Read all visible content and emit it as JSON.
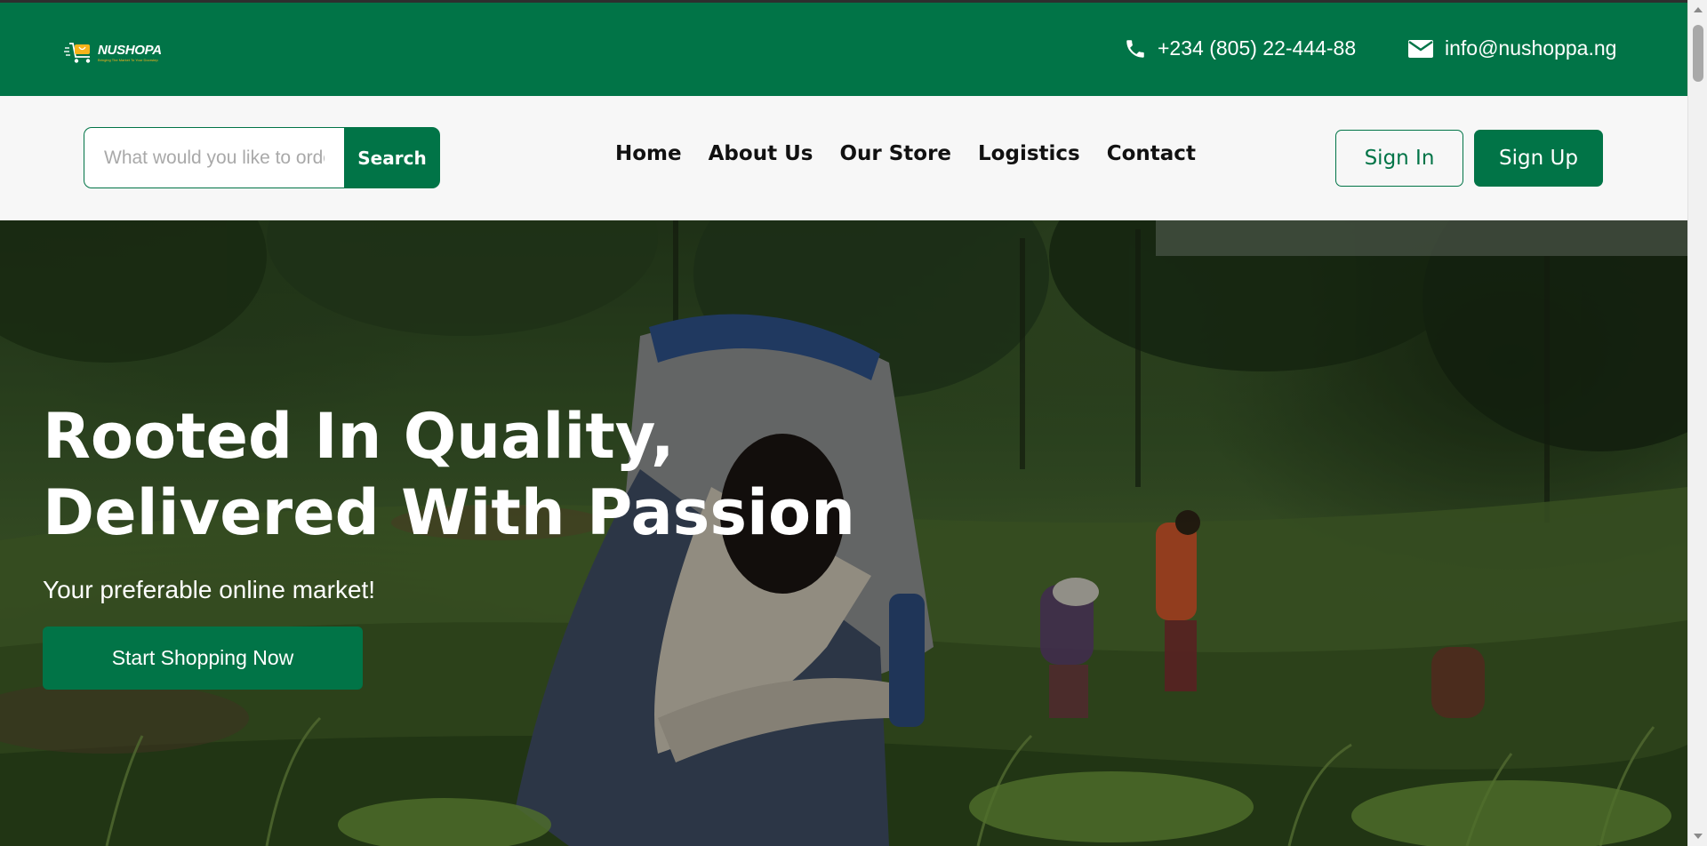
{
  "brand": {
    "name": "NUSHOPA",
    "tagline": "Bringing The Market To Your Doorstep",
    "primary_color": "#017447",
    "accent_color": "#f5b41b"
  },
  "topbar": {
    "phone": "+234 (805) 22-444-88",
    "phone_icon": "phone-icon",
    "email": "info@nushoppa.ng",
    "email_icon": "mail-icon"
  },
  "search": {
    "placeholder": "What would you like to order?",
    "value": "",
    "button_label": "Search"
  },
  "nav": {
    "items": [
      {
        "label": "Home"
      },
      {
        "label": "About Us"
      },
      {
        "label": "Our Store"
      },
      {
        "label": "Logistics"
      },
      {
        "label": "Contact"
      }
    ]
  },
  "auth": {
    "signin_label": "Sign In",
    "signup_label": "Sign Up"
  },
  "hero": {
    "title": "Rooted In Quality, Delivered With Passion",
    "subtitle": "Your preferable online market!",
    "cta_label": "Start Shopping Now",
    "background": "Farmers working in a green field"
  }
}
